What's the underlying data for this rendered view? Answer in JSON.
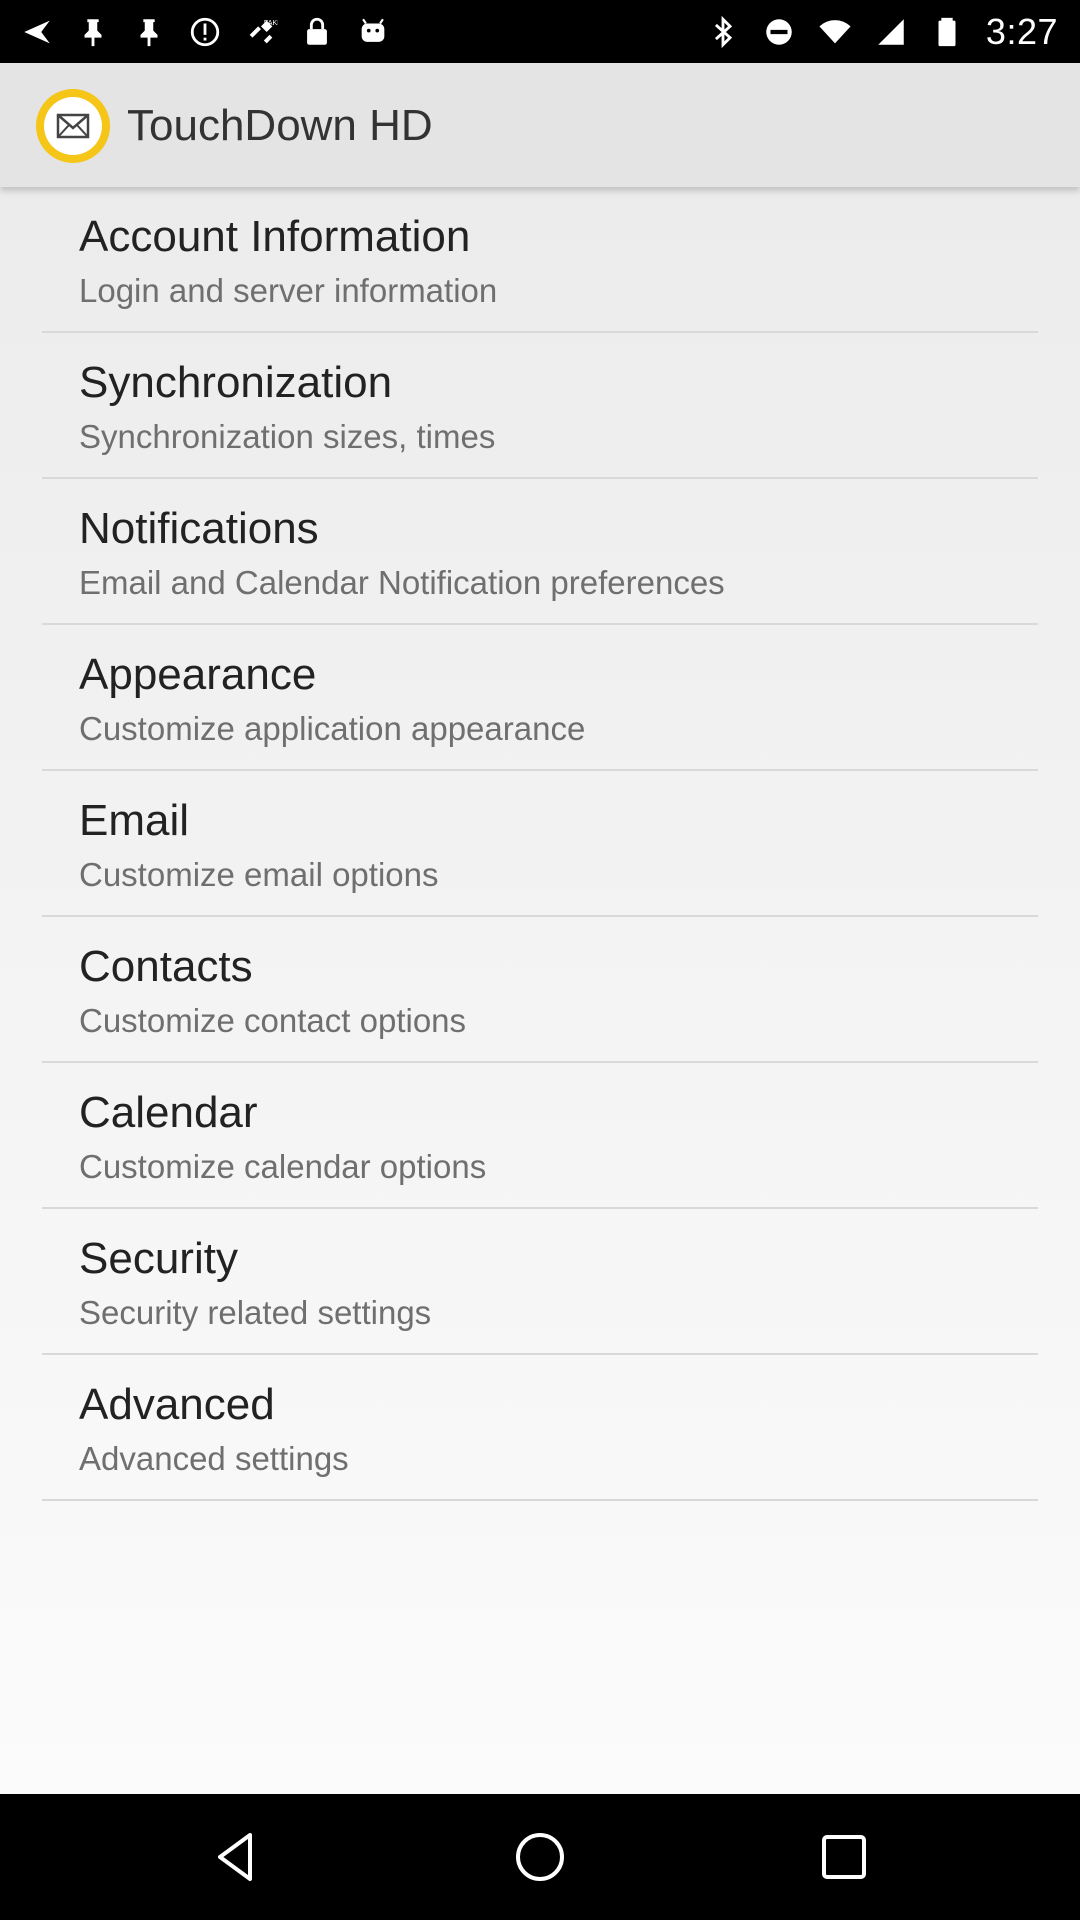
{
  "status_bar": {
    "time": "3:27",
    "left_icons": [
      "navigation-arrow-icon",
      "pin-icon",
      "pin-icon",
      "alert-circle-icon",
      "fake-gps-icon",
      "lock-icon",
      "android-icon"
    ],
    "right_icons": [
      "bluetooth-icon",
      "do-not-disturb-icon",
      "wifi-icon",
      "cell-signal-icon",
      "battery-icon"
    ]
  },
  "app_bar": {
    "title": "TouchDown HD",
    "logo_icon": "touchdown-mail-logo-icon",
    "logo_ring_color": "#f5c518"
  },
  "settings": {
    "items": [
      {
        "title": "Account Information",
        "summary": "Login and server information"
      },
      {
        "title": "Synchronization",
        "summary": "Synchronization sizes, times"
      },
      {
        "title": "Notifications",
        "summary": "Email and Calendar Notification preferences"
      },
      {
        "title": "Appearance",
        "summary": "Customize application appearance"
      },
      {
        "title": "Email",
        "summary": "Customize email options"
      },
      {
        "title": "Contacts",
        "summary": "Customize contact options"
      },
      {
        "title": "Calendar",
        "summary": "Customize calendar options"
      },
      {
        "title": "Security",
        "summary": "Security related settings"
      },
      {
        "title": "Advanced",
        "summary": "Advanced settings"
      }
    ]
  },
  "nav_bar": {
    "buttons": [
      "back-icon",
      "home-icon",
      "recents-icon"
    ]
  }
}
